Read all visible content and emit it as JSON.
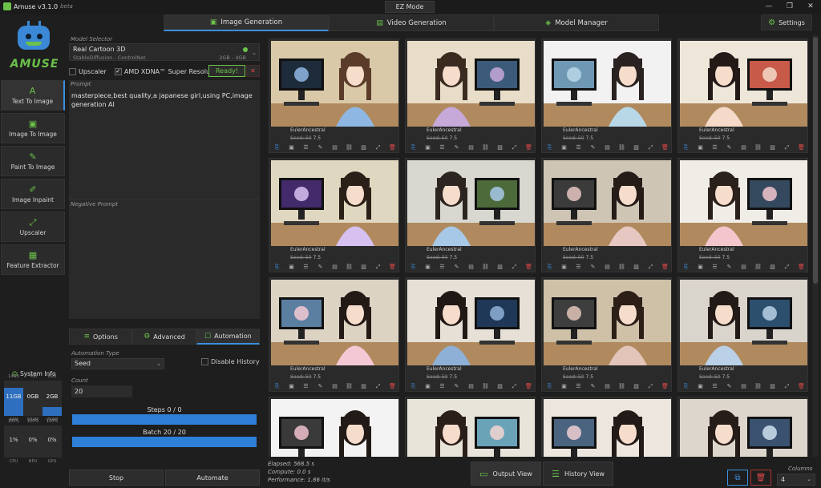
{
  "app": {
    "title": "Amuse v3.1.0",
    "beta": "beta",
    "ez_mode": "EZ Mode",
    "logo_text": "AMUSE"
  },
  "tabs": [
    {
      "label": "Image Generation",
      "icon": "image-icon"
    },
    {
      "label": "Video Generation",
      "icon": "film-icon"
    },
    {
      "label": "Model Manager",
      "icon": "layers-icon"
    }
  ],
  "settings_label": "Settings",
  "nav": [
    {
      "label": "Text To Image",
      "icon": "text-icon"
    },
    {
      "label": "Image To Image",
      "icon": "image-icon"
    },
    {
      "label": "Paint To Image",
      "icon": "paint-icon"
    },
    {
      "label": "Image Inpaint",
      "icon": "edit-icon"
    },
    {
      "label": "Upscaler",
      "icon": "expand-icon"
    },
    {
      "label": "Feature Extractor",
      "icon": "feature-icon"
    }
  ],
  "sysinfo": {
    "title": "System Info",
    "caps": [
      "14GB",
      "7GB",
      "8GB"
    ],
    "values": [
      "11GB",
      "0GB",
      "2GB"
    ],
    "labels": [
      "RAM",
      "SRAM",
      "VRAM"
    ],
    "levels": [
      0.79,
      0.0,
      0.25
    ],
    "pct_caps": [
      "100%",
      "100%",
      "100%"
    ],
    "pct_values": [
      "1%",
      "0%",
      "0%"
    ],
    "pct_labels": [
      "CPU",
      "NPU",
      "GPU"
    ]
  },
  "model": {
    "label": "Model Selector",
    "name": "Real Cartoon 3D",
    "sub": "StableDiffusion - ControlNet",
    "memory": "2GB - 4GB"
  },
  "options": {
    "upscaler": "Upscaler",
    "amd": "AMD XDNA™ Super Resolution",
    "ready": "Ready!",
    "close": "✕"
  },
  "prompt": {
    "label": "Prompt",
    "text": "masterpiece,best quality,a japanese girl,using PC,image generation AI"
  },
  "negative_prompt": {
    "label": "Negative Prompt"
  },
  "subtabs": [
    "Options",
    "Advanced",
    "Automation"
  ],
  "automation": {
    "type_label": "Automation Type",
    "type_value": "Seed",
    "disable_history": "Disable History",
    "count_label": "Count",
    "count_value": "20",
    "steps_label": "Steps 0 / 0",
    "steps_progress": 1.0,
    "batch_label": "Batch 20 / 20",
    "batch_progress": 1.0
  },
  "buttons": {
    "stop": "Stop",
    "automate": "Automate"
  },
  "gallery": {
    "meta1": "EulerAncestral",
    "meta2_prefix": "Seed: 50",
    "meta2_suffix": "7.5",
    "row_icons": [
      "save-icon",
      "image-icon",
      "list-icon",
      "edit-icon",
      "film-icon",
      "link-icon",
      "image-gallery-icon",
      "upscale-icon",
      "delete-icon"
    ]
  },
  "stats": {
    "elapsed": "Elapsed: 568.5 s",
    "compute": "Compute: 0.0 s",
    "performance": "Performance: 1.86 it/s"
  },
  "views": {
    "output": "Output View",
    "history": "History View"
  },
  "columns": {
    "label": "Columns",
    "value": "4"
  },
  "colors": {
    "accent": "#3b8fe0",
    "brand": "#6cc24a",
    "danger": "#e04848"
  }
}
